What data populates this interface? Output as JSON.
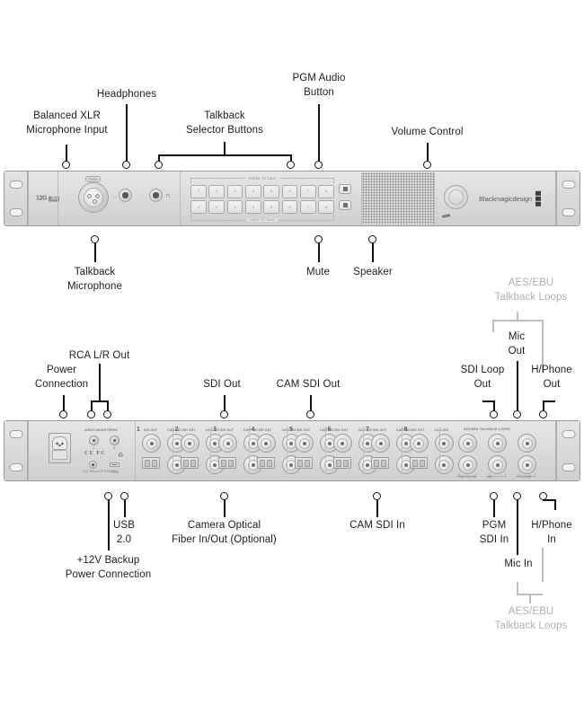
{
  "diagram": {
    "title": "Blackmagic Design talkback unit front and rear panel connection diagram"
  },
  "front_panel": {
    "callouts_top": [
      {
        "label": "Balanced XLR\nMicrophone Input"
      },
      {
        "label": "Headphones"
      },
      {
        "label": "Talkback\nSelector Buttons"
      },
      {
        "label": "PGM Audio\nButton"
      },
      {
        "label": "Volume Control"
      }
    ],
    "callouts_bottom": [
      {
        "label": "Talkback\nMicrophone"
      },
      {
        "label": "Mute"
      },
      {
        "label": "Speaker"
      }
    ],
    "device": {
      "model_badge": "12G",
      "model_tag": "3G",
      "brand": "Blackmagicdesign",
      "xlr_push_label": "PUSH",
      "button_rail_top": "PRESS TO TALK",
      "button_rail_bottom": "LOCK TO TALK",
      "talkback_buttons_row1": [
        "1",
        "2",
        "3",
        "4",
        "5",
        "6",
        "7",
        "8"
      ],
      "talkback_buttons_row2": [
        "1",
        "2",
        "3",
        "4",
        "5",
        "6",
        "7",
        "8"
      ]
    }
  },
  "rear_panel": {
    "callouts_top_left": [
      {
        "label": "Power\nConnection"
      },
      {
        "label": "RCA L/R Out"
      },
      {
        "label": "SDI Out"
      },
      {
        "label": "CAM SDI Out"
      }
    ],
    "callouts_top_right": [
      {
        "label": "SDI Loop\nOut"
      },
      {
        "label": "Mic\nOut"
      },
      {
        "label": "H/Phone\nOut"
      }
    ],
    "callouts_bottom_left": [
      {
        "label": "+12V Backup\nPower Connection"
      },
      {
        "label": "USB\n2.0"
      },
      {
        "label": "Camera Optical\nFiber In/Out (Optional)"
      },
      {
        "label": "CAM SDI In"
      }
    ],
    "callouts_bottom_right": [
      {
        "label": "PGM\nSDI In"
      },
      {
        "label": "Mic In"
      },
      {
        "label": "H/Phone\nIn"
      }
    ],
    "aes_label_top": "AES/EBU\nTalkback Loops",
    "aes_label_bottom": "AES/EBU\nTalkback Loops",
    "device": {
      "audio_monitoring_label": "AUDIO MONITORING",
      "rca_left_label": "L",
      "rca_right_label": "R",
      "cert_marks": "CE FC",
      "backup_power_label": "+12V BACKUP\nPOWER",
      "usb_label": "USB",
      "loops_header": "AES/EBU TALKBACK LOOPS",
      "channels": [
        {
          "num": "1",
          "sdi_out": "SDI OUT",
          "cam_sdi": "CAM SDI",
          "optical": "CAM SDI\nOPTICAL"
        },
        {
          "num": "2",
          "sdi_out": "SDI OUT",
          "cam_sdi": "CAM SDI",
          "optical": "CAM SDI\nOPTICAL"
        },
        {
          "num": "3",
          "sdi_out": "SDI OUT",
          "cam_sdi": "CAM SDI",
          "optical": "CAM SDI\nOPTICAL"
        },
        {
          "num": "4",
          "sdi_out": "SDI OUT",
          "cam_sdi": "CAM SDI",
          "optical": "CAM SDI\nOPTICAL"
        },
        {
          "num": "5",
          "sdi_out": "SDI OUT",
          "cam_sdi": "CAM SDI",
          "optical": "CAM SDI\nOPTICAL"
        },
        {
          "num": "6",
          "sdi_out": "SDI OUT",
          "cam_sdi": "CAM SDI",
          "optical": "CAM SDI\nOPTICAL"
        },
        {
          "num": "7",
          "sdi_out": "SDI OUT",
          "cam_sdi": "CAM SDI",
          "optical": "CAM SDI\nOPTICAL"
        },
        {
          "num": "8",
          "sdi_out": "SDI OUT",
          "cam_sdi": "CAM SDI",
          "optical": "CAM SDI\nOPTICAL"
        }
      ],
      "loop_labels": [
        "PGM SDI IN",
        "MIC",
        "H/PHONE"
      ]
    }
  },
  "colors": {
    "line": "#111111",
    "muted": "#b0b0b0",
    "chassis": "#dedede"
  }
}
